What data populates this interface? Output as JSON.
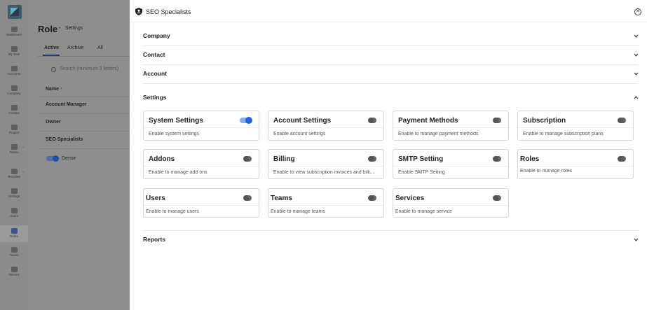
{
  "sidebar": {
    "items": [
      {
        "label": "Dashboard"
      },
      {
        "label": "My Task"
      },
      {
        "label": "Accounts"
      },
      {
        "label": "Company"
      },
      {
        "label": "Contact"
      },
      {
        "label": "Project"
      },
      {
        "label": "Teams"
      },
      {
        "label": "Template"
      },
      {
        "label": "Settings"
      },
      {
        "label": "Users"
      },
      {
        "label": "Roles"
      },
      {
        "label": "Teams"
      },
      {
        "label": "Service"
      }
    ]
  },
  "page": {
    "title": "Role",
    "breadcrumb": "Settings",
    "tabs": [
      "Active",
      "Archive",
      "All"
    ],
    "search_placeholder": "Search (minimum 3 letters)",
    "column_name": "Name ↑",
    "rows": [
      "Account Manager",
      "Owner",
      "SEO Specialists"
    ],
    "dense_label": "Dense"
  },
  "panel": {
    "title": "SEO Specialists",
    "sections": {
      "company": "Company",
      "contact": "Contact",
      "account": "Account",
      "settings": "Settings",
      "reports": "Reports"
    },
    "cards": [
      {
        "title": "System Settings",
        "desc": "Enable system settings",
        "enabled": true
      },
      {
        "title": "Account Settings",
        "desc": "Enable account settings",
        "enabled": false
      },
      {
        "title": "Payment Methods",
        "desc": "Enable to manage payment methods",
        "enabled": false
      },
      {
        "title": "Subscription",
        "desc": "Enable to manage subscription plans",
        "enabled": false
      },
      {
        "title": "Addons",
        "desc": "Enable to manage add ons",
        "enabled": false
      },
      {
        "title": "Billing",
        "desc": "Enable to view subscription invoices and billi...",
        "enabled": false
      },
      {
        "title": "SMTP Setting",
        "desc": "Enable SMTP Setting",
        "enabled": false
      },
      {
        "title": "Roles",
        "desc": "Enable to manage roles",
        "enabled": false
      },
      {
        "title": "Users",
        "desc": "Enable to manage users",
        "enabled": false
      },
      {
        "title": "Teams",
        "desc": "Enable to manage teams",
        "enabled": false
      },
      {
        "title": "Services",
        "desc": "Enable to manage service",
        "enabled": false
      }
    ]
  },
  "colors": {
    "toggle_on": "#2563d6",
    "toggle_off": "#666666",
    "overlay": "#8e8e8e"
  }
}
